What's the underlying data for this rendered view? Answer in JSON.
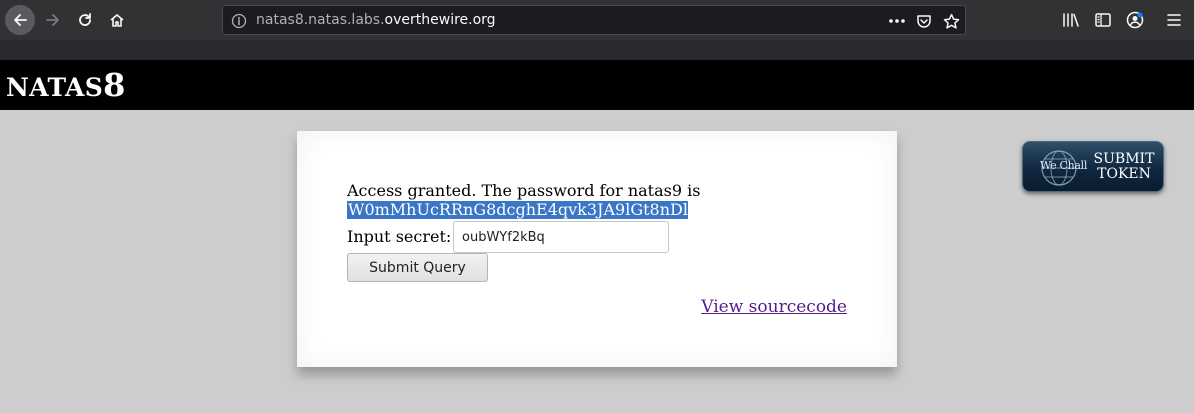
{
  "browser": {
    "url_prefix": "natas8.natas.labs.",
    "url_host": "overthewire.org",
    "colors": {
      "toolbar": "#323234",
      "urlbar": "#1c1b22"
    },
    "icons": [
      "back-arrow-icon",
      "forward-arrow-icon",
      "reload-icon",
      "home-icon",
      "info-icon",
      "more-icon",
      "pocket-icon",
      "star-icon",
      "library-icon",
      "sidebar-icon",
      "account-icon",
      "menu-icon"
    ]
  },
  "header": {
    "title_prefix": "NATAS",
    "title_number": "8"
  },
  "content": {
    "message": "Access granted. The password for natas9 is",
    "password": "W0mMhUcRRnG8dcghE4qvk3JA9lGt8nDl",
    "input_label": "Input secret:",
    "input_value": "oubWYf2kBq",
    "submit_label": "Submit Query",
    "source_link": "View sourcecode"
  },
  "wechall": {
    "brand": "We Chall",
    "line1": "SUBMIT",
    "line2": "TOKEN"
  }
}
